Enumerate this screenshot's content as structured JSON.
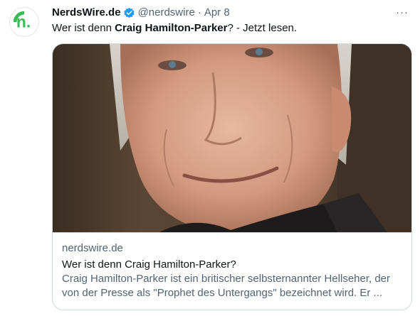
{
  "account": {
    "name": "NerdsWire.de",
    "handle": "@nerdswire",
    "separator": "·",
    "date": "Apr 8",
    "verified": true,
    "avatar_icon": "nerdswire-logo-icon",
    "avatar_letter": "n."
  },
  "tweet": {
    "text_before": "Wer ist denn ",
    "text_bold": "Craig Hamilton-Parker",
    "text_after": "? - Jetzt lesen.",
    "more_label": "···"
  },
  "card": {
    "domain": "nerdswire.de",
    "title": "Wer ist denn Craig Hamilton-Parker?",
    "description": "Craig Hamilton-Parker ist ein britischer selbsternannter Hellseher, der von der Presse als \"Prophet des Untergangs\" bezeichnet wird. Er ..."
  },
  "colors": {
    "text_primary": "#0f1419",
    "text_secondary": "#536471",
    "border": "#cfd9de",
    "verified_blue": "#1d9bf0",
    "logo_green": "#3dbb57"
  }
}
